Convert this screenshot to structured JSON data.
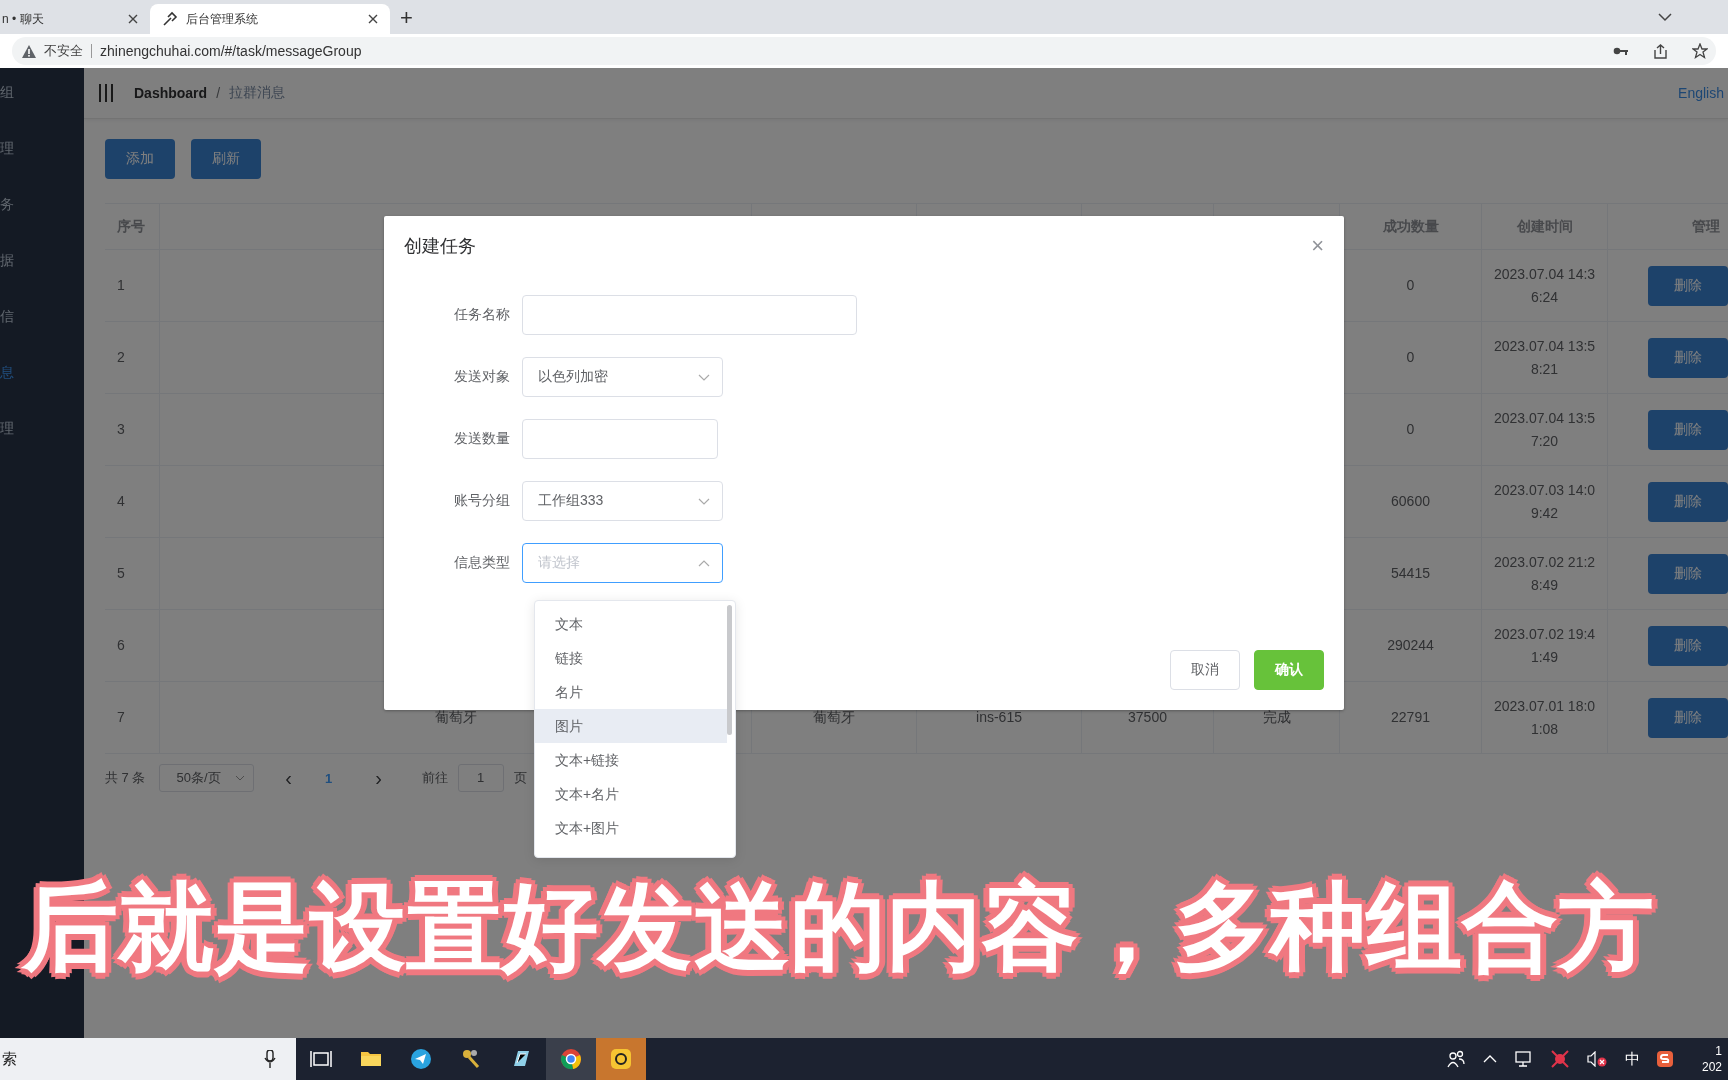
{
  "browser": {
    "tabs": [
      {
        "title": "n • 聊天",
        "selected": false
      },
      {
        "title": "后台管理系统",
        "selected": true
      }
    ],
    "new_tab": "+",
    "address": {
      "security": "不安全",
      "url": "zhinengchuhai.com/#/task/messageGroup"
    }
  },
  "sidebar": {
    "items": [
      {
        "label": "组",
        "selected": false
      },
      {
        "label": "理",
        "selected": false
      },
      {
        "label": "务",
        "selected": false
      },
      {
        "label": "据",
        "selected": false
      },
      {
        "label": "信",
        "selected": false
      },
      {
        "label": "息",
        "selected": true
      },
      {
        "label": "理",
        "selected": false
      }
    ]
  },
  "header": {
    "breadcrumb": [
      "Dashboard",
      "拉群消息"
    ],
    "separator": "/",
    "language": "English"
  },
  "toolbar": {
    "buttons": [
      "添加",
      "刷新"
    ]
  },
  "table": {
    "columns": [
      "序号",
      null,
      null,
      null,
      null,
      null,
      "成功数量",
      "创建时间",
      "管理"
    ],
    "rows": [
      {
        "cells": [
          "1",
          null,
          null,
          null,
          null,
          null,
          "0",
          "2023.07.04 14:36:24"
        ],
        "action": "删除"
      },
      {
        "cells": [
          "2",
          null,
          null,
          null,
          null,
          null,
          "0",
          "2023.07.04 13:58:21"
        ],
        "action": "删除"
      },
      {
        "cells": [
          "3",
          null,
          null,
          null,
          null,
          null,
          "0",
          "2023.07.04 13:57:20"
        ],
        "action": "删除"
      },
      {
        "cells": [
          "4",
          null,
          null,
          null,
          null,
          null,
          "60600",
          "2023.07.03 14:09:42"
        ],
        "action": "删除"
      },
      {
        "cells": [
          "5",
          null,
          null,
          null,
          null,
          null,
          "54415",
          "2023.07.02 21:28:49"
        ],
        "action": "删除"
      },
      {
        "cells": [
          "6",
          null,
          null,
          null,
          null,
          null,
          "290244",
          "2023.07.02 19:41:49"
        ],
        "action": "删除"
      },
      {
        "cells": [
          "7",
          "葡萄牙",
          "葡萄牙",
          "ins-615",
          "37500",
          "完成",
          "22791",
          "2023.07.01 18:01:08"
        ],
        "action": "删除"
      }
    ]
  },
  "pagination": {
    "total": "共 7 条",
    "page_size": "50条/页",
    "prev": "‹",
    "pages": [
      {
        "label": "1",
        "selected": true
      }
    ],
    "next": "›",
    "goto_label": "前往",
    "goto_value": "1",
    "goto_suffix": "页"
  },
  "dialog": {
    "title": "创建任务",
    "close": "×",
    "fields": [
      {
        "label": "任务名称",
        "kind": "text_input"
      },
      {
        "label": "发送对象",
        "kind": "select",
        "value": "以色列加密",
        "expanded": false
      },
      {
        "label": "发送数量",
        "kind": "number_input"
      },
      {
        "label": "账号分组",
        "kind": "select",
        "value": "工作组333",
        "expanded": false
      },
      {
        "label": "信息类型",
        "kind": "select",
        "placeholder": "请选择",
        "expanded": true
      }
    ],
    "dropdown": [
      {
        "label": "文本",
        "highlighted": false
      },
      {
        "label": "链接",
        "highlighted": false
      },
      {
        "label": "名片",
        "highlighted": false
      },
      {
        "label": "图片",
        "highlighted": true
      },
      {
        "label": "文本+链接",
        "highlighted": false
      },
      {
        "label": "文本+名片",
        "highlighted": false
      },
      {
        "label": "文本+图片",
        "highlighted": false
      }
    ],
    "buttons": [
      {
        "label": "取消",
        "kind": "secondary"
      },
      {
        "label": "确认",
        "kind": "primary"
      }
    ]
  },
  "subtitle": "后就是设置好发送的内容，多种组合方",
  "taskbar": {
    "search": "索",
    "tray_ime": "中",
    "clock": [
      "1",
      "202"
    ]
  }
}
